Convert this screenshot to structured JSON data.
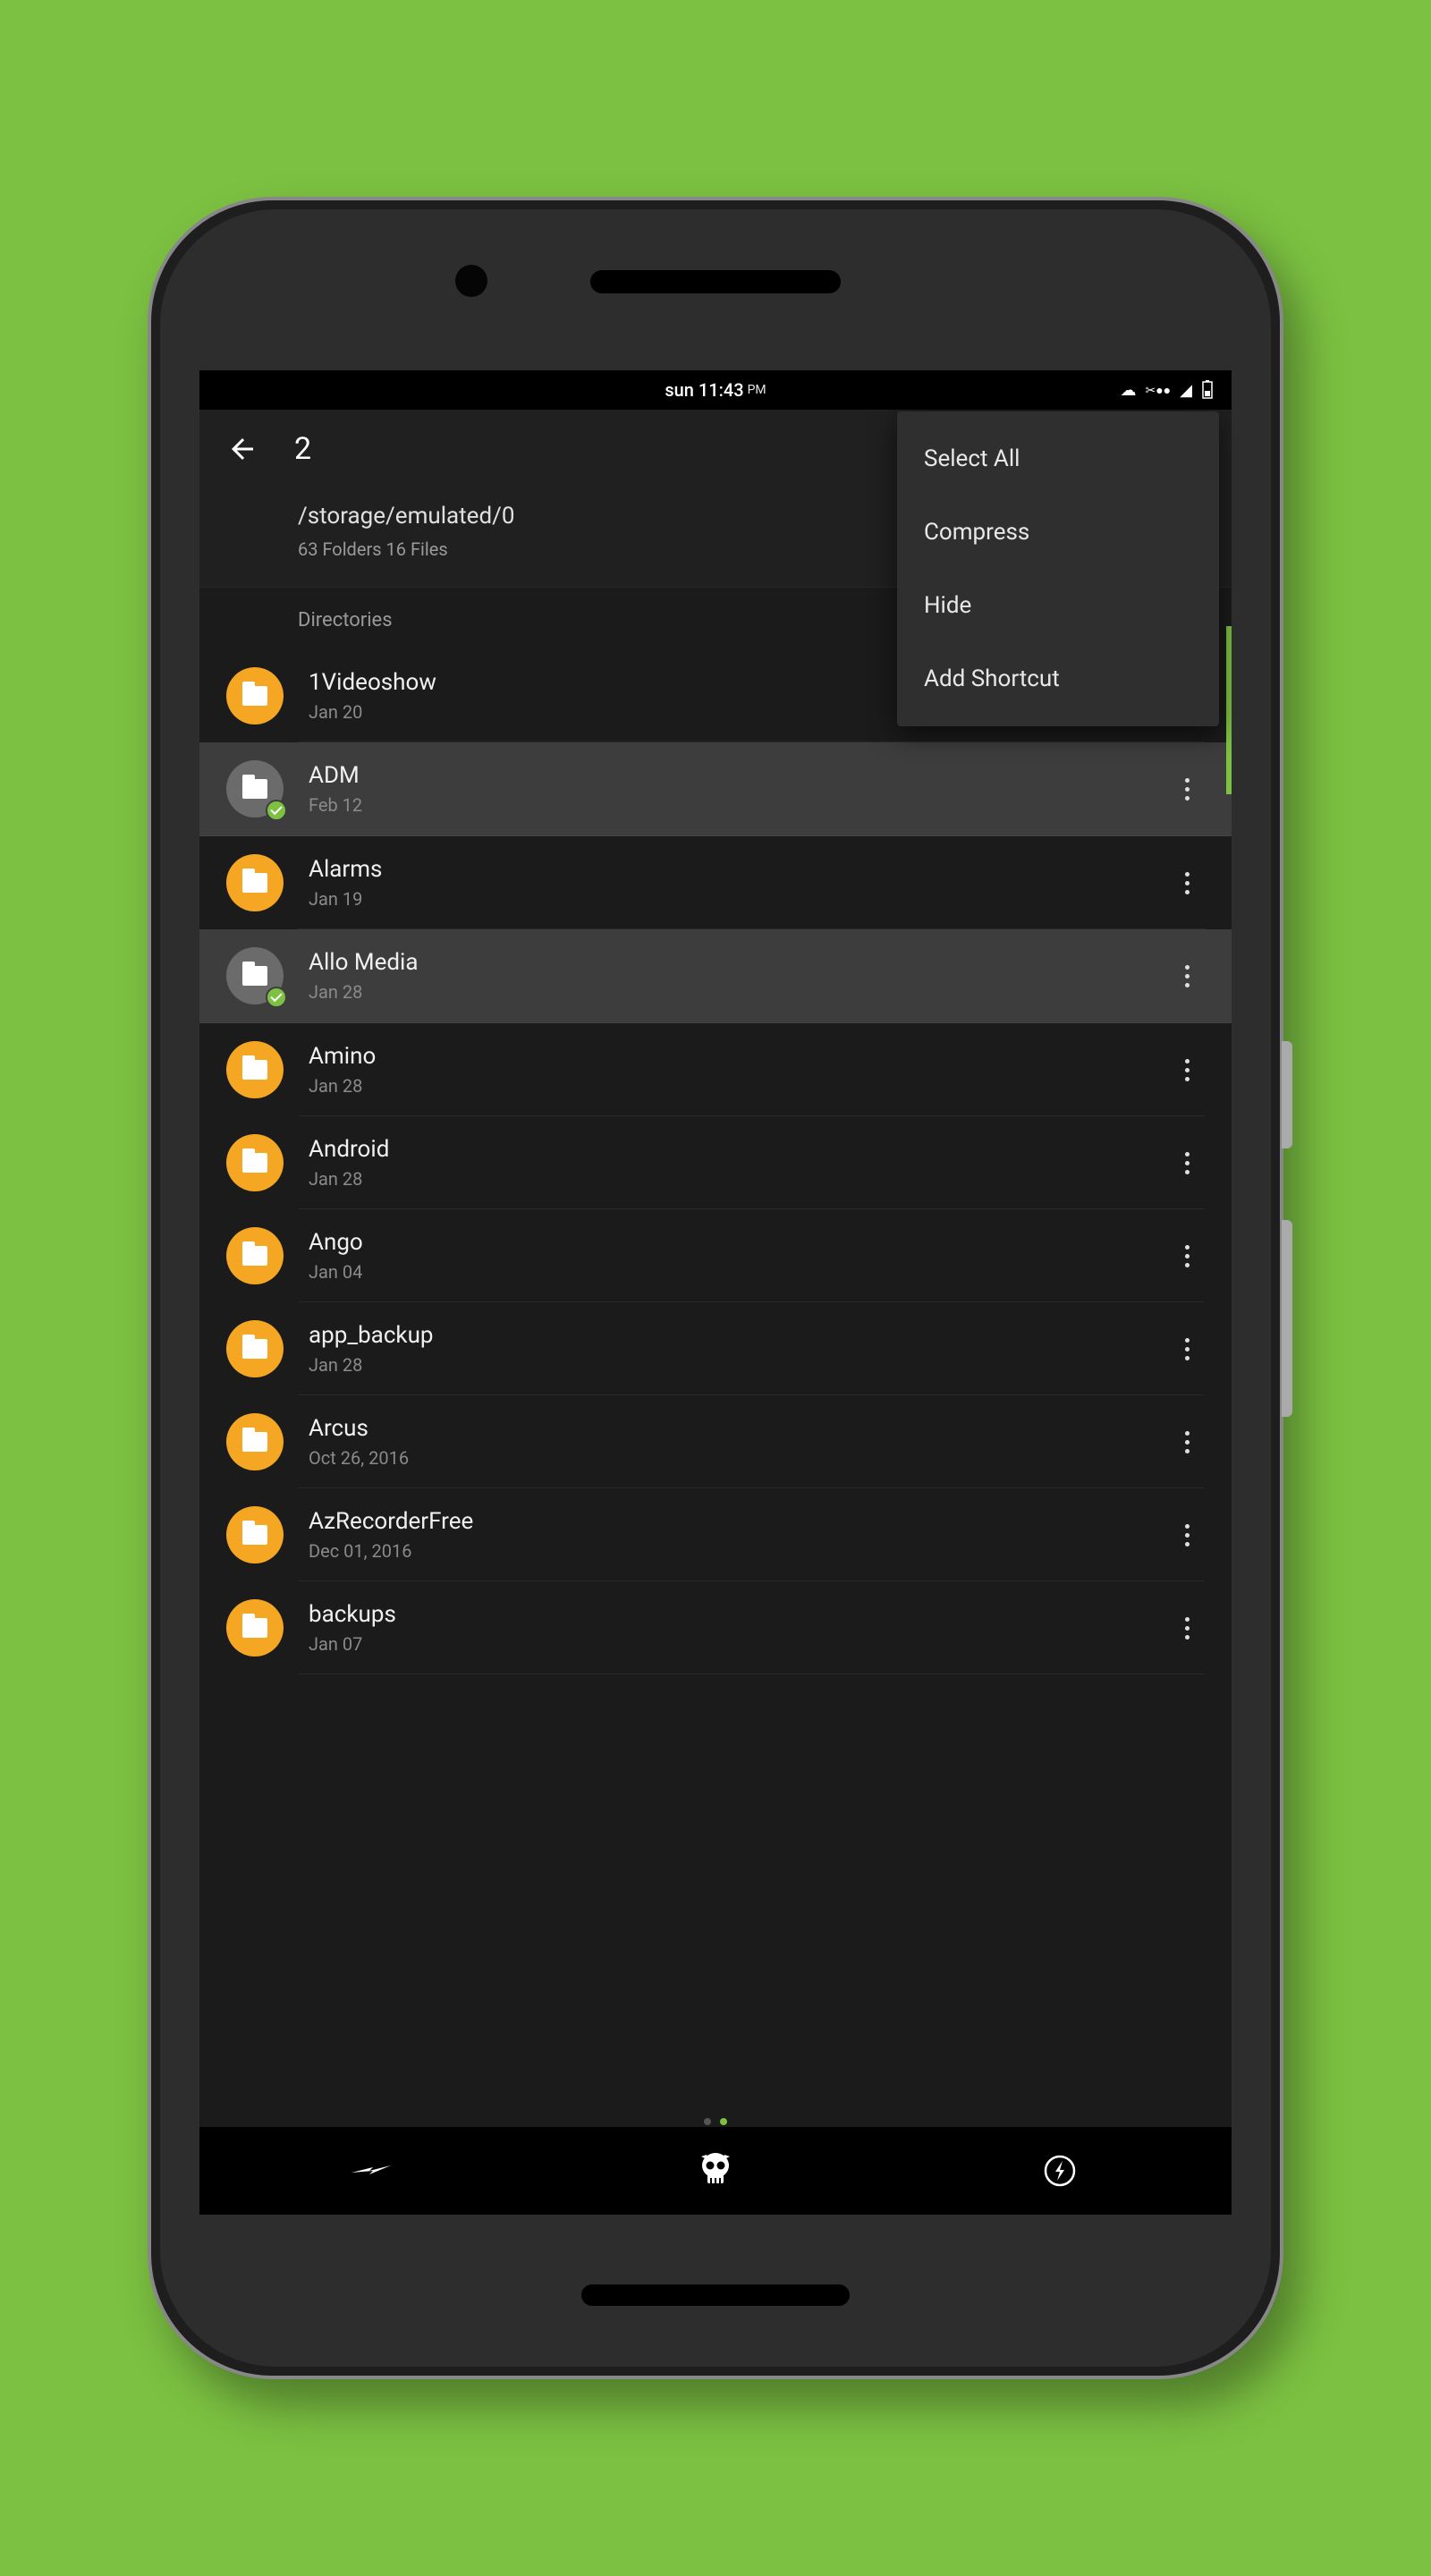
{
  "status": {
    "time": "sun 11:43",
    "ampm": "PM"
  },
  "header": {
    "selection_count": "2",
    "path": "/storage/emulated/0",
    "stats": "63 Folders 16 Files"
  },
  "section_label": "Directories",
  "menu": {
    "items": [
      "Select All",
      "Compress",
      "Hide",
      "Add Shortcut"
    ]
  },
  "folders": [
    {
      "name": "1Videoshow",
      "date": "Jan 20",
      "selected": false
    },
    {
      "name": "ADM",
      "date": "Feb 12",
      "selected": true
    },
    {
      "name": "Alarms",
      "date": "Jan 19",
      "selected": false
    },
    {
      "name": "Allo Media",
      "date": "Jan 28",
      "selected": true
    },
    {
      "name": "Amino",
      "date": "Jan 28",
      "selected": false
    },
    {
      "name": "Android",
      "date": "Jan 28",
      "selected": false
    },
    {
      "name": "Ango",
      "date": "Jan 04",
      "selected": false
    },
    {
      "name": "app_backup",
      "date": "Jan 28",
      "selected": false
    },
    {
      "name": "Arcus",
      "date": "Oct 26, 2016",
      "selected": false
    },
    {
      "name": "AzRecorderFree",
      "date": "Dec 01, 2016",
      "selected": false
    },
    {
      "name": "backups",
      "date": "Jan 07",
      "selected": false
    }
  ]
}
